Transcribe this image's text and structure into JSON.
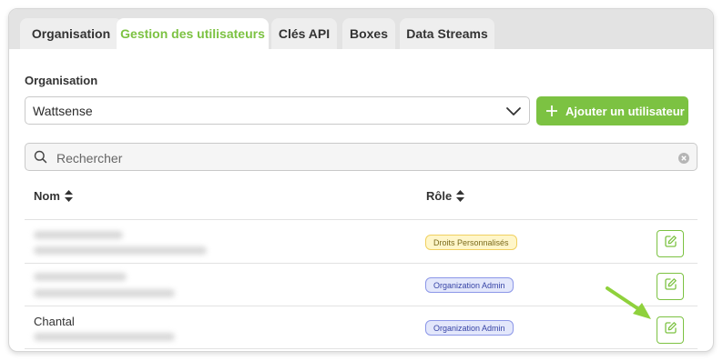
{
  "tabs": [
    {
      "label": "Organisation",
      "active": false
    },
    {
      "label": "Gestion des utilisateurs",
      "active": true
    },
    {
      "label": "Clés API",
      "active": false
    },
    {
      "label": "Boxes",
      "active": false
    },
    {
      "label": "Data Streams",
      "active": false
    }
  ],
  "organisation": {
    "label": "Organisation",
    "selected": "Wattsense"
  },
  "add_user_label": "Ajouter un utilisateur",
  "search": {
    "placeholder": "Rechercher",
    "value": ""
  },
  "table": {
    "columns": [
      "Nom",
      "Rôle"
    ],
    "rows": [
      {
        "name": "",
        "role": "Droits Personnalisés",
        "role_style": "yellow"
      },
      {
        "name": "",
        "role": "Organization Admin",
        "role_style": "blue"
      },
      {
        "name": "Chantal",
        "role": "Organization Admin",
        "role_style": "blue"
      }
    ]
  },
  "colors": {
    "accent": "#7cc242",
    "badge_yellow": "#fff6c9",
    "badge_blue": "#e3e7fb"
  },
  "icons": [
    "chevron-down-icon",
    "plus-icon",
    "search-icon",
    "clear-icon",
    "sort-icon",
    "edit-icon",
    "arrow-pointer-icon"
  ]
}
